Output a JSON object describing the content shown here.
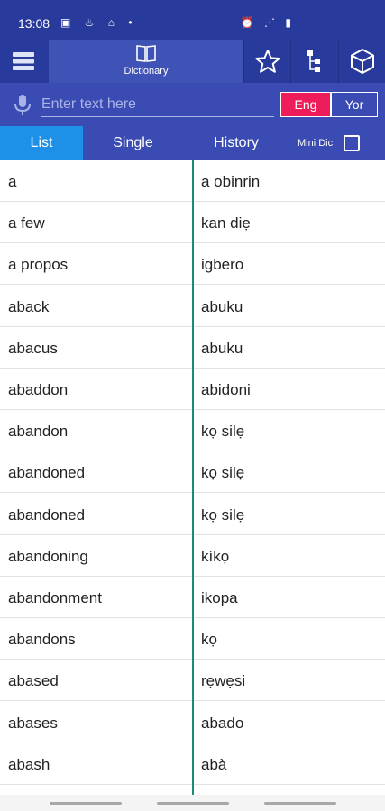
{
  "status": {
    "time": "13:08",
    "left_icons": "▣ ♨ ⌂ •",
    "right_icons": "⏰ ⋰ ▮"
  },
  "toolbar": {
    "menu_icon": "menu-icon",
    "dictionary_label": "Dictionary",
    "buttons": [
      "star-icon",
      "tree-icon",
      "cube-icon"
    ]
  },
  "search": {
    "placeholder": "Enter text here",
    "value": ""
  },
  "languages": {
    "source": "Eng",
    "target": "Yor",
    "active": "Eng",
    "active_color": "#ee1d5a"
  },
  "tabs": [
    {
      "label": "List",
      "active": true
    },
    {
      "label": "Single",
      "active": false
    },
    {
      "label": "History",
      "active": false
    }
  ],
  "mini_dic": {
    "label": "Mini Dic",
    "checked": false
  },
  "entries": [
    {
      "en": "a",
      "yo": "a obinrin"
    },
    {
      "en": "a few",
      "yo": "kan diẹ"
    },
    {
      "en": "a propos",
      "yo": "igbero"
    },
    {
      "en": "aback",
      "yo": "abuku"
    },
    {
      "en": "abacus",
      "yo": "abuku"
    },
    {
      "en": "abaddon",
      "yo": "abidoni"
    },
    {
      "en": "abandon",
      "yo": "kọ silẹ"
    },
    {
      "en": "abandoned",
      "yo": "kọ silẹ"
    },
    {
      "en": "abandoned",
      "yo": "kọ silẹ"
    },
    {
      "en": "abandoning",
      "yo": "kíkọ"
    },
    {
      "en": "abandonment",
      "yo": "ikopa"
    },
    {
      "en": "abandons",
      "yo": "kọ"
    },
    {
      "en": "abased",
      "yo": "rẹwẹsi"
    },
    {
      "en": "abases",
      "yo": "abado"
    },
    {
      "en": "abash",
      "yo": "abà"
    }
  ],
  "colors": {
    "header": "#283a9c",
    "search_bg": "#3a4cb4",
    "tab_active": "#1e90e8",
    "divider": "#1a8a7a"
  }
}
